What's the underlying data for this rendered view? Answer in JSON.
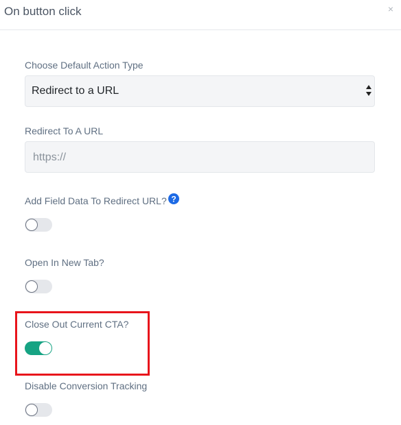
{
  "dialog": {
    "title": "On button click",
    "close_glyph": "×"
  },
  "fields": {
    "action_type": {
      "label": "Choose Default Action Type",
      "value": "Redirect to a URL"
    },
    "redirect_url": {
      "label": "Redirect To A URL",
      "placeholder": "https://"
    },
    "add_field_data": {
      "label": "Add Field Data To Redirect URL?",
      "enabled": false,
      "help_icon": "question-circle-icon"
    },
    "open_new_tab": {
      "label": "Open In New Tab?",
      "enabled": false
    },
    "close_cta": {
      "label": "Close Out Current CTA?",
      "enabled": true,
      "highlighted": true
    },
    "disable_tracking": {
      "label": "Disable Conversion Tracking",
      "enabled": false
    }
  },
  "colors": {
    "toggle_on": "#16a383",
    "toggle_off": "#e5e7eb",
    "highlight_border": "#e8141b",
    "help_icon": "#1d6ae5"
  }
}
